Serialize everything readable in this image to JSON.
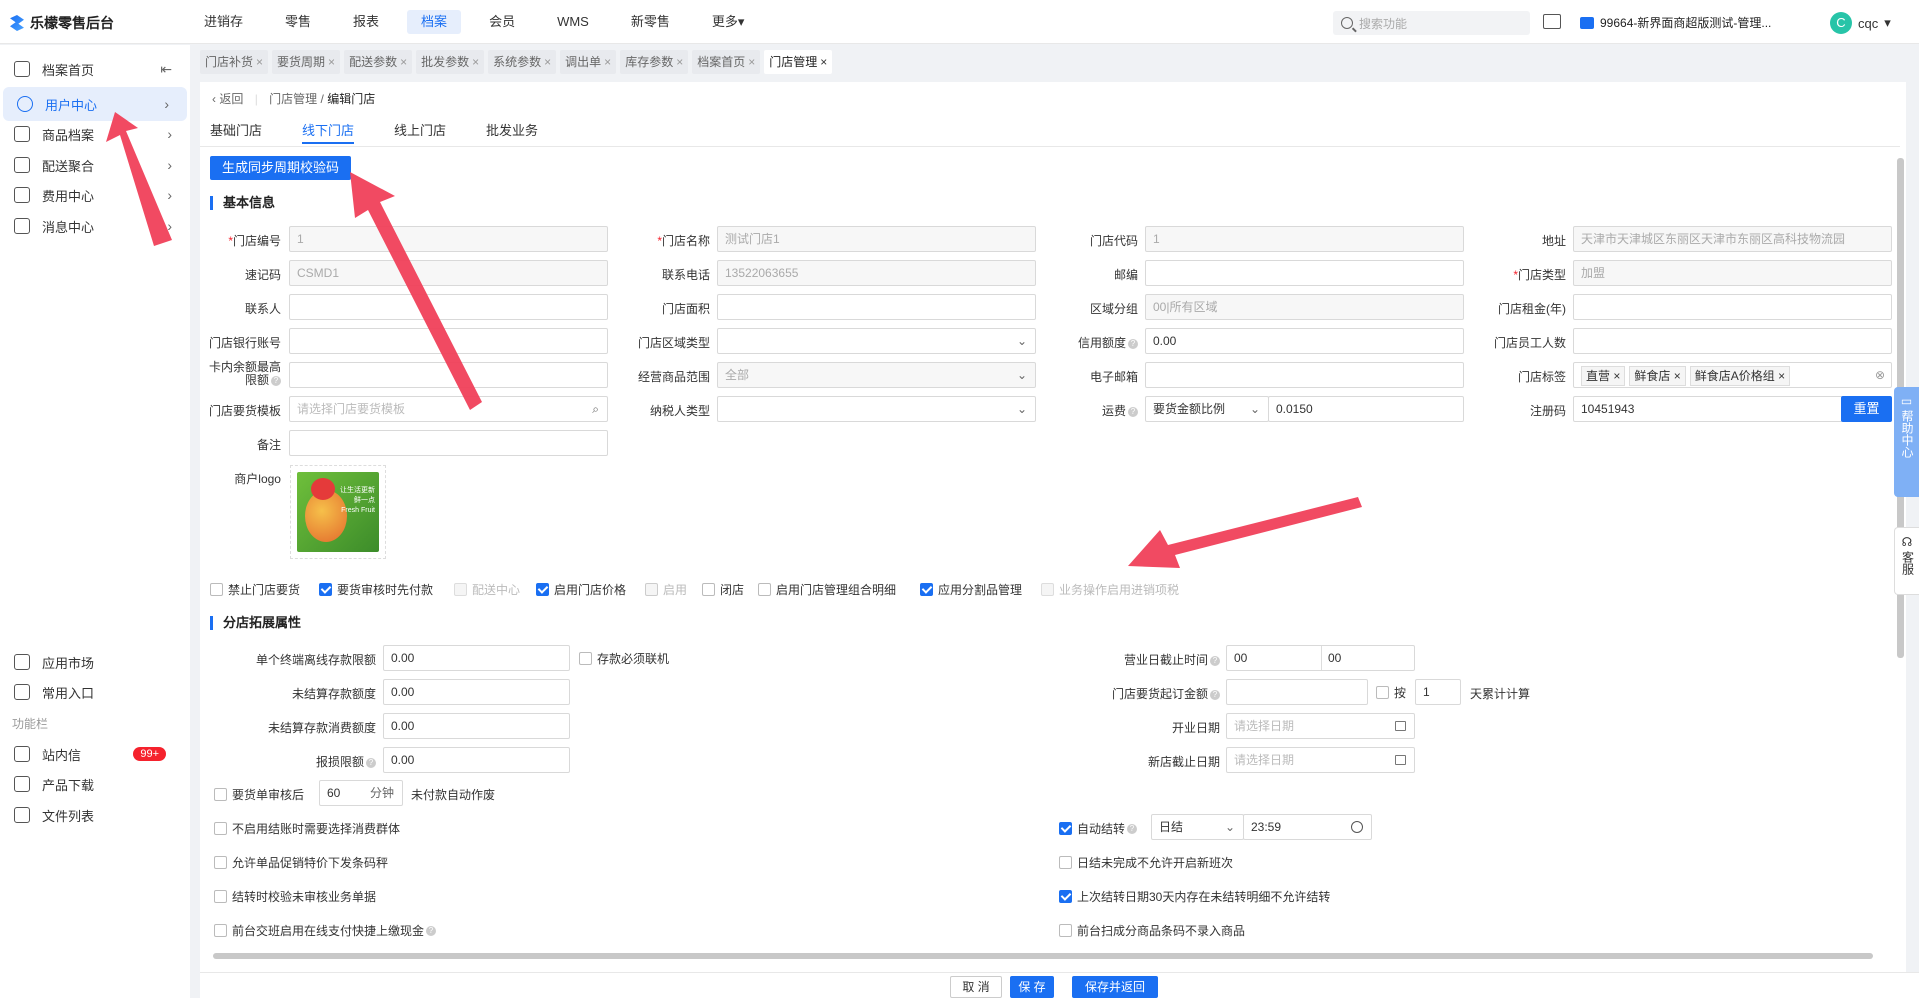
{
  "app": {
    "title": "乐檬零售后台"
  },
  "topnav": [
    "进销存",
    "零售",
    "报表",
    "档案",
    "会员",
    "WMS",
    "新零售",
    "更多"
  ],
  "topnav_active": 3,
  "search_placeholder": "搜索功能",
  "store_name": "99664-新界面商超版测试-管理...",
  "user": {
    "initial": "C",
    "name": "cqc"
  },
  "sidebar": {
    "items": [
      {
        "label": "档案首页"
      },
      {
        "label": "用户中心"
      },
      {
        "label": "商品档案"
      },
      {
        "label": "配送聚合"
      },
      {
        "label": "费用中心"
      },
      {
        "label": "消息中心"
      }
    ],
    "bottom": [
      {
        "label": "应用市场"
      },
      {
        "label": "常用入口"
      }
    ],
    "section_label": "功能栏",
    "func": [
      {
        "label": "站内信",
        "badge": "99+"
      },
      {
        "label": "产品下载"
      },
      {
        "label": "文件列表"
      }
    ]
  },
  "tabs": [
    "门店补货",
    "要货周期",
    "配送参数",
    "批发参数",
    "系统参数",
    "调出单",
    "库存参数",
    "档案首页",
    "门店管理"
  ],
  "breadcrumb": {
    "back": "返回",
    "parent": "门店管理",
    "current": "编辑门店"
  },
  "subtabs": [
    "基础门店",
    "线下门店",
    "线上门店",
    "批发业务"
  ],
  "generate_btn": "生成同步周期校验码",
  "basic_title": "基本信息",
  "fields": {
    "store_no": {
      "label": "门店编号",
      "value": "1"
    },
    "store_name": {
      "label": "门店名称",
      "value": "测试门店1"
    },
    "store_code": {
      "label": "门店代码",
      "value": "1"
    },
    "address": {
      "label": "地址",
      "value": "天津市天津城区东丽区天津市东丽区高科技物流园"
    },
    "quick_code": {
      "label": "速记码",
      "value": "CSMD1"
    },
    "phone": {
      "label": "联系电话",
      "value": "13522063655"
    },
    "postcode": {
      "label": "邮编",
      "value": ""
    },
    "store_type": {
      "label": "门店类型",
      "value": "加盟"
    },
    "contact": {
      "label": "联系人",
      "value": ""
    },
    "area": {
      "label": "门店面积",
      "value": ""
    },
    "region": {
      "label": "区域分组",
      "value": "00|所有区域"
    },
    "rent": {
      "label": "门店租金(年)",
      "value": ""
    },
    "bank": {
      "label": "门店银行账号",
      "value": ""
    },
    "region_type": {
      "label": "门店区域类型",
      "value": ""
    },
    "credit": {
      "label": "信用额度",
      "value": "0.00"
    },
    "staff": {
      "label": "门店员工人数",
      "value": ""
    },
    "card_max": {
      "label1": "卡内余额最高",
      "label2": "限额",
      "value": ""
    },
    "scope": {
      "label": "经营商品范围",
      "value": "全部"
    },
    "email": {
      "label": "电子邮箱",
      "value": ""
    },
    "tags": {
      "label": "门店标签",
      "values": [
        "直营",
        "鲜食店",
        "鲜食店A价格组"
      ]
    },
    "template": {
      "label": "门店要货模板",
      "placeholder": "请选择门店要货模板"
    },
    "taxpayer": {
      "label": "纳税人类型",
      "value": ""
    },
    "freight": {
      "label": "运费",
      "mode": "要货金额比例",
      "value": "0.0150"
    },
    "reg_code": {
      "label": "注册码",
      "value": "10451943",
      "reset": "重置"
    },
    "remark": {
      "label": "备注",
      "value": ""
    },
    "logo": {
      "label": "商户logo",
      "img_text": "让生活更新鲜一点 Fresh Fruit"
    }
  },
  "checks": [
    {
      "label": "禁止门店要货",
      "on": false,
      "dis": false
    },
    {
      "label": "要货审核时先付款",
      "on": true,
      "dis": false
    },
    {
      "label": "配送中心",
      "on": false,
      "dis": true
    },
    {
      "label": "启用门店价格",
      "on": true,
      "dis": false
    },
    {
      "label": "启用",
      "on": true,
      "dis": true
    },
    {
      "label": "闭店",
      "on": false,
      "dis": false
    },
    {
      "label": "启用门店管理组合明细",
      "on": false,
      "dis": false
    },
    {
      "label": "应用分割品管理",
      "on": true,
      "dis": false
    },
    {
      "label": "业务操作启用进销项税",
      "on": false,
      "dis": true
    }
  ],
  "ext_title": "分店拓展属性",
  "ext": {
    "offline_limit": {
      "label": "单个终端离线存款限额",
      "value": "0.00"
    },
    "deposit_online": {
      "label": "存款必须联机"
    },
    "unsettled_amt": {
      "label": "未结算存款额度",
      "value": "0.00"
    },
    "unsettled_consume": {
      "label": "未结算存款消费额度",
      "value": "0.00"
    },
    "loss_limit": {
      "label": "报损限额",
      "value": "0.00"
    },
    "biz_end": {
      "label": "营业日截止时间",
      "h": "00",
      "m": "00"
    },
    "order_min": {
      "label": "门店要货起订金额",
      "value": "",
      "by": "按",
      "days": "1",
      "suffix": "天累计计算"
    },
    "open_date": {
      "label": "开业日期",
      "placeholder": "请选择日期"
    },
    "new_end": {
      "label": "新店截止日期",
      "placeholder": "请选择日期"
    },
    "audit_after": {
      "label": "要货单审核后",
      "value": "60",
      "unit": "分钟",
      "suffix": "未付款自动作废"
    },
    "auto_close": {
      "label": "自动结转",
      "mode": "日结",
      "time": "23:59"
    }
  },
  "ext_checks_left": [
    {
      "label": "不启用结账时需要选择消费群体",
      "on": false
    },
    {
      "label": "允许单品促销特价下发条码秤",
      "on": false
    },
    {
      "label": "结转时校验未审核业务单据",
      "on": false
    },
    {
      "label": "前台交班启用在线支付快捷上缴现金",
      "on": false
    }
  ],
  "ext_checks_right": [
    {
      "label": "日结未完成不允许开启新班次",
      "on": false
    },
    {
      "label": "上次结转日期30天内存在未结转明细不允许结转",
      "on": true
    },
    {
      "label": "前台扫成分商品条码不录入商品",
      "on": false
    }
  ],
  "footer": {
    "cancel": "取 消",
    "save": "保 存",
    "save_return": "保存并返回"
  },
  "help": {
    "label": "帮助中心"
  },
  "service": {
    "label": "客服"
  },
  "colors": {
    "accent": "#1a6ff2",
    "arrow": "#f0405a"
  }
}
